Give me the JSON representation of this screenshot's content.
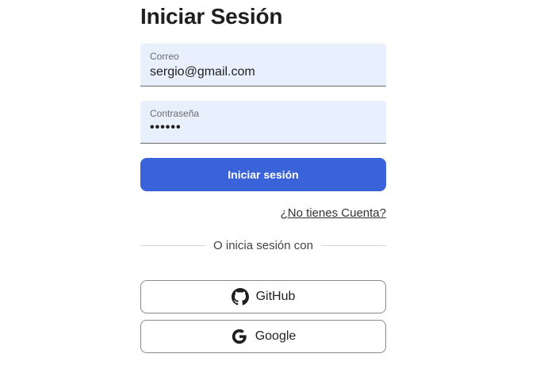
{
  "login": {
    "title": "Iniciar Sesión",
    "email": {
      "label": "Correo",
      "value": "sergio@gmail.com"
    },
    "password": {
      "label": "Contraseña",
      "value": "••••••"
    },
    "submit_label": "Iniciar sesión",
    "register_link": "¿No tienes Cuenta?",
    "divider_text": "O inicia sesión con",
    "social": {
      "github_label": "GitHub",
      "github_icon": "github-icon",
      "google_label": "Google",
      "google_icon": "google-icon"
    }
  },
  "colors": {
    "primary": "#3b63d9",
    "field_bg": "#e8f0fe",
    "text": "#1f1f1f"
  }
}
